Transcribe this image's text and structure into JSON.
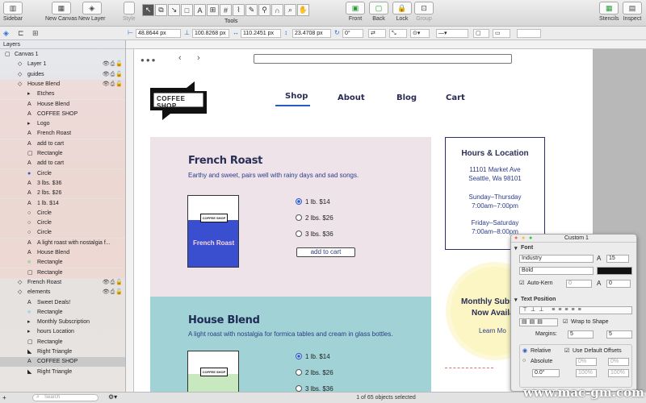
{
  "toolbar": {
    "sidebar": "Sidebar",
    "new_canvas": "New Canvas",
    "new_layer": "New Layer",
    "style": "Style",
    "tools": "Tools",
    "front": "Front",
    "back": "Back",
    "lock": "Lock",
    "group": "Group",
    "stencils": "Stencils",
    "inspect": "Inspect"
  },
  "toolbar_icons": [
    "arrow-tool-icon",
    "selection-tool-icon",
    "line-tool-icon",
    "shape-tool-icon",
    "text-tool-icon",
    "table-tool-icon",
    "diagram-tool-icon",
    "style-tool-icon",
    "pen-tool-icon",
    "rubber-stamp-icon",
    "magnet-icon",
    "zoom-icon",
    "hand-icon"
  ],
  "inspector_bar": {
    "x": "48.8644 px",
    "y": "100.8268 px",
    "w": "110.2451 px",
    "h": "23.4708 px",
    "angle": "0°"
  },
  "sidebar": {
    "header": "Layers",
    "search_placeholder": "Search",
    "rows": [
      {
        "label": "Canvas 1"
      },
      {
        "label": "Layer 1"
      },
      {
        "label": "guides"
      },
      {
        "label": "House Blend"
      },
      {
        "label": "Etches"
      },
      {
        "label": "House Blend"
      },
      {
        "label": "COFFEE SHOP"
      },
      {
        "label": "Logo"
      },
      {
        "label": "French Roast"
      },
      {
        "label": "add to cart"
      },
      {
        "label": "Rectangle"
      },
      {
        "label": "add to cart"
      },
      {
        "label": "Circle"
      },
      {
        "label": "3 lbs. $36"
      },
      {
        "label": "2 lbs. $26"
      },
      {
        "label": "1 lb. $14"
      },
      {
        "label": "Circle"
      },
      {
        "label": "Circle"
      },
      {
        "label": "Circle"
      },
      {
        "label": "A light roast with nostalgia f..."
      },
      {
        "label": "House Blend"
      },
      {
        "label": "Rectangle"
      },
      {
        "label": "Rectangle"
      },
      {
        "label": "French Roast"
      },
      {
        "label": "elements"
      },
      {
        "label": "Sweet Deals!"
      },
      {
        "label": "Rectangle"
      },
      {
        "label": "Monthly Subscription"
      },
      {
        "label": "hours Location"
      },
      {
        "label": "Rectangle"
      },
      {
        "label": "Right Triangle"
      },
      {
        "label": "COFFEE SHOP"
      },
      {
        "label": "Right Triangle"
      }
    ]
  },
  "status": "1 of 65 objects selected",
  "site": {
    "logo": "COFFEE SHOP",
    "nav": [
      "Shop",
      "About",
      "Blog",
      "Cart"
    ],
    "products": [
      {
        "title": "French Roast",
        "desc": "Earthy and sweet, pairs well with rainy days and sad songs.",
        "pack_brand": "COFFEE SHOP",
        "pack_name": "French Roast",
        "options": [
          "1 lb. $14",
          "2 lbs. $26",
          "3 lbs. $36"
        ],
        "button": "add to cart"
      },
      {
        "title": "House Blend",
        "desc": "A light roast with nostalgia for formica tables and cream in glass bottles.",
        "pack_brand": "COFFEE SHOP",
        "options": [
          "1 lb. $14",
          "2 lbs. $26",
          "3 lbs. $36"
        ]
      }
    ],
    "hours": {
      "title": "Hours & Location",
      "addr1": "11101 Market Ave",
      "addr2": "Seattle, Wa 98101",
      "d1": "Sunday–Thursday",
      "t1": "7:00am–7:00pm",
      "d2": "Friday–Saturday",
      "t2": "7:00am–8:00pm"
    },
    "promo": {
      "l1": "Monthly Subscr",
      "l2": "Now Availab",
      "l3": "Learn Mo"
    }
  },
  "panel": {
    "title": "Custom 1",
    "font_header": "Font",
    "font": "Industry",
    "weight": "Bold",
    "size": "15",
    "autokern": "Auto-Kern",
    "kern": "0",
    "baseline": "0",
    "text_pos_header": "Text Position",
    "wrap": "Wrap to Shape",
    "margins": "Margins:",
    "m1": "5",
    "m2": "5",
    "relative": "Relative",
    "absolute": "Absolute",
    "defaults": "Use Default Offsets",
    "rot": "0.0°",
    "pct": "100%",
    "zero": "0%"
  },
  "watermark": "www.mac-gm.com",
  "colors": {
    "pink": "#efe3ea",
    "teal": "#a0d2d6",
    "blue": "#2b59c3",
    "navy": "#2a2f55"
  }
}
